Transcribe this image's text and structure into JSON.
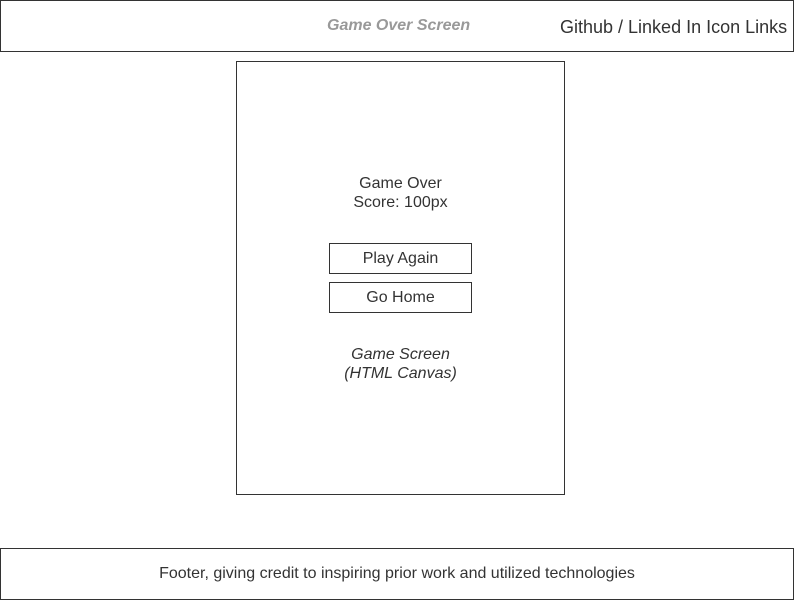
{
  "header": {
    "screen_title": "Game Over Screen",
    "links_label": "Github / Linked In Icon Links"
  },
  "game": {
    "title": "Game Over",
    "score_text": "Score: 100px",
    "play_again_label": "Play Again",
    "go_home_label": "Go Home",
    "canvas_label_line1": "Game Screen",
    "canvas_label_line2": "(HTML Canvas)"
  },
  "footer": {
    "text": "Footer, giving credit to inspiring prior work and utilized technologies"
  },
  "colors": {
    "border": "#333333",
    "title_gray": "#999999",
    "text": "#333333",
    "background": "#ffffff"
  }
}
